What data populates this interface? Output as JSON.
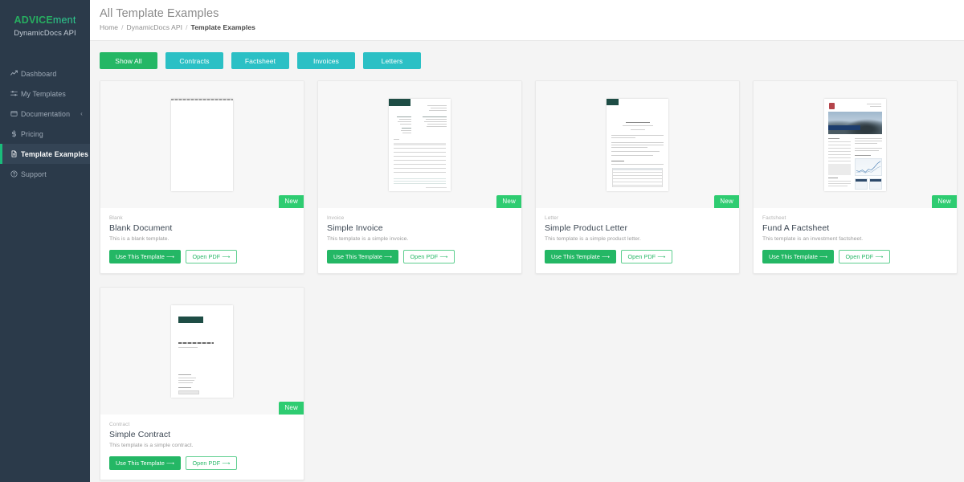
{
  "sidebar": {
    "logo_part1": "ADVICE",
    "logo_part2": "ment",
    "subtitle": "DynamicDocs API",
    "items": [
      {
        "label": "Dashboard",
        "icon": "chart-line-icon",
        "active": false,
        "caret": ""
      },
      {
        "label": "My Templates",
        "icon": "sliders-icon",
        "active": false,
        "caret": ""
      },
      {
        "label": "Documentation",
        "icon": "book-icon",
        "active": false,
        "caret": "‹"
      },
      {
        "label": "Pricing",
        "icon": "dollar-icon",
        "active": false,
        "caret": ""
      },
      {
        "label": "Template Examples",
        "icon": "file-text-icon",
        "active": true,
        "caret": ""
      },
      {
        "label": "Support",
        "icon": "help-circle-icon",
        "active": false,
        "caret": ""
      }
    ]
  },
  "header": {
    "title": "All Template Examples",
    "breadcrumb": [
      {
        "label": "Home",
        "current": false
      },
      {
        "label": "DynamicDocs API",
        "current": false
      },
      {
        "label": "Template Examples",
        "current": true
      }
    ],
    "separator": "/"
  },
  "filters": [
    {
      "label": "Show All",
      "active": true
    },
    {
      "label": "Contracts",
      "active": false
    },
    {
      "label": "Factsheet",
      "active": false
    },
    {
      "label": "Invoices",
      "active": false
    },
    {
      "label": "Letters",
      "active": false
    }
  ],
  "buttons": {
    "use_template": "Use This Template ⟶",
    "open_pdf": "Open PDF ⟶"
  },
  "badge": {
    "new": "New"
  },
  "cards": [
    {
      "category": "Blank",
      "title": "Blank Document",
      "description": "This is a blank template.",
      "thumbnail": "blank-document-thumbnail",
      "badge": "New"
    },
    {
      "category": "Invoice",
      "title": "Simple Invoice",
      "description": "This template is a simple invoice.",
      "thumbnail": "invoice-thumbnail",
      "badge": "New"
    },
    {
      "category": "Letter",
      "title": "Simple Product Letter",
      "description": "This template is a simple product letter.",
      "thumbnail": "product-letter-thumbnail",
      "badge": "New"
    },
    {
      "category": "Factsheet",
      "title": "Fund A Factsheet",
      "description": "This template is an investment factsheet.",
      "thumbnail": "factsheet-thumbnail",
      "badge": "New"
    },
    {
      "category": "Contract",
      "title": "Simple Contract",
      "description": "This template is a simple contract.",
      "thumbnail": "contract-thumbnail",
      "badge": "New"
    }
  ],
  "colors": {
    "sidebar_bg": "#2b3a4a",
    "sidebar_active_bg": "#344455",
    "accent_green": "#24b765",
    "accent_teal": "#2bc0c5",
    "badge_green": "#2ecc71",
    "page_bg": "#f4f4f4"
  }
}
